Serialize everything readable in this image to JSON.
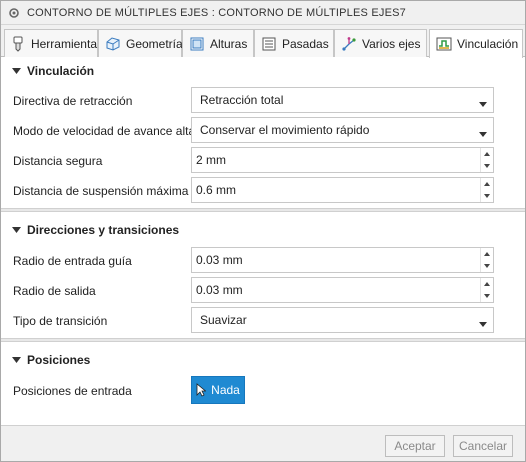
{
  "window": {
    "title": "CONTORNO DE MÚLTIPLES EJES : CONTORNO DE MÚLTIPLES EJES7"
  },
  "tabs": [
    {
      "label": "Herramienta",
      "icon": "tool-icon",
      "active": false
    },
    {
      "label": "Geometría",
      "icon": "geometry-icon",
      "active": false
    },
    {
      "label": "Alturas",
      "icon": "heights-icon",
      "active": false
    },
    {
      "label": "Pasadas",
      "icon": "passes-icon",
      "active": false
    },
    {
      "label": "Varios ejes",
      "icon": "multi-axis-icon",
      "active": false
    },
    {
      "label": "Vinculación",
      "icon": "linking-icon",
      "active": true
    }
  ],
  "sections": {
    "vinculacion": {
      "title": "Vinculación",
      "retract_policy_label": "Directiva de retracción",
      "retract_policy_value": "Retracción total",
      "feed_mode_label": "Modo de velocidad de avance alta",
      "feed_mode_value": "Conservar el movimiento rápido",
      "safe_distance_label": "Distancia segura",
      "safe_distance_value": "2 mm",
      "max_stay_down_label": "Distancia de suspensión máxima",
      "max_stay_down_value": "0.6 mm"
    },
    "direcciones": {
      "title": "Direcciones y transiciones",
      "lead_in_label": "Radio de entrada guía",
      "lead_in_value": "0.03 mm",
      "lead_out_label": "Radio de salida",
      "lead_out_value": "0.03 mm",
      "transition_label": "Tipo de transición",
      "transition_value": "Suavizar"
    },
    "posiciones": {
      "title": "Posiciones",
      "entry_positions_label": "Posiciones de entrada",
      "entry_positions_button": "Nada"
    }
  },
  "footer": {
    "ok_label": "Aceptar",
    "cancel_label": "Cancelar"
  },
  "colors": {
    "accent": "#1f8ad2",
    "panel_bg": "#f0f0f0",
    "border": "#c8c8c8"
  }
}
